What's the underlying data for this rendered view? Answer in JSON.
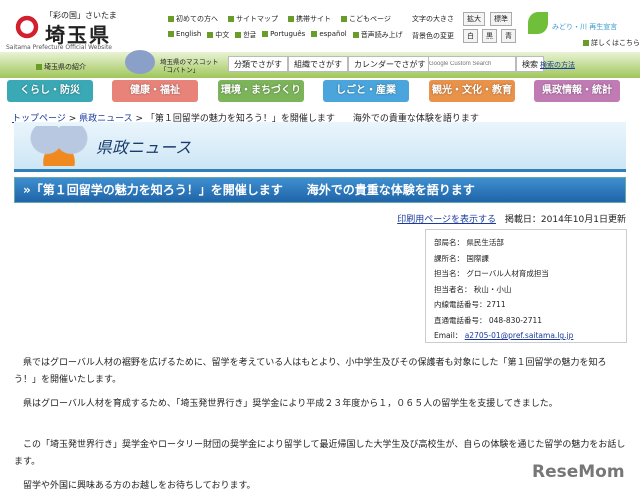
{
  "logo": {
    "tagline": "「彩の国」さいたま",
    "name": "埼玉県",
    "english": "Saitama Prefecture Official Website",
    "intro_link": "埼玉県の紹介"
  },
  "top_links": [
    "初めての方へ",
    "サイトマップ",
    "携帯サイト",
    "こどもページ"
  ],
  "lang_links": [
    "English",
    "中文",
    "한글",
    "Português",
    "español",
    "音声読み上げ"
  ],
  "font_size": {
    "label": "文字の大きさ",
    "buttons": [
      "拡大",
      "標準"
    ]
  },
  "bg_color": {
    "label": "背景色の変更",
    "buttons": [
      "白",
      "黒",
      "青"
    ]
  },
  "campaign": {
    "title": "みどり・川 再生宣言",
    "link": "詳しくはこちら"
  },
  "mascot": {
    "label": "埼玉県のマスコット「コバトン」"
  },
  "search": {
    "buttons": [
      "分類でさがす",
      "組織でさがす",
      "カレンダーでさがす"
    ],
    "placeholder": "Google Custom Search",
    "submit": "検索",
    "help": "検索の方法"
  },
  "nav": [
    {
      "label": "くらし・防災",
      "color": "#3aa9b5"
    },
    {
      "label": "健康・福祉",
      "color": "#e8837a"
    },
    {
      "label": "環境・まちづくり",
      "color": "#7cb45a"
    },
    {
      "label": "しごと・産業",
      "color": "#4aa5dc"
    },
    {
      "label": "観光・文化・教育",
      "color": "#e9924a"
    },
    {
      "label": "県政情報・統計",
      "color": "#c07bb4"
    }
  ],
  "breadcrumb": {
    "items": [
      "トップページ",
      "県政ニュース"
    ],
    "current": "「第１回留学の魅力を知ろう！」を開催します　　海外での貴重な体験を語ります"
  },
  "banner": {
    "title": "県政ニュース"
  },
  "page_title": "»「第１回留学の魅力を知ろう！」を開催します　　海外での貴重な体験を語ります",
  "print_link": "印刷用ページを表示する",
  "date": "掲載日：2014年10月1日更新",
  "contact": [
    {
      "label": "部局名：",
      "value": "県民生活部"
    },
    {
      "label": "課所名：",
      "value": "国際課"
    },
    {
      "label": "担当名：",
      "value": "グローバル人材育成担当"
    },
    {
      "label": "担当者名：",
      "value": "秋山・小山"
    },
    {
      "label": "内線電話番号：",
      "value": "2711"
    },
    {
      "label": "直通電話番号：",
      "value": "048-830-2711"
    },
    {
      "label": "Email：",
      "value": "a2705-01@pref.saitama.lg.jp"
    }
  ],
  "paragraphs": [
    "県ではグローバル人材の裾野を広げるために、留学を考えている人はもとより、小中学生及びその保護者も対象にした「第１回留学の魅力を知ろう！」を開催いたします。",
    "県はグローバル人材を育成するため、「埼玉発世界行き」奨学金により平成２３年度から１，０６５人の留学生を支援してきました。",
    "この「埼玉発世界行き」奨学金やロータリー財団の奨学金により留学して最近帰国した大学生及び高校生が、自らの体験を通じた留学の魅力をお話します。",
    "留学や外国に興味ある方のお越しをお待ちしております。"
  ],
  "watermark": "ReseMom"
}
